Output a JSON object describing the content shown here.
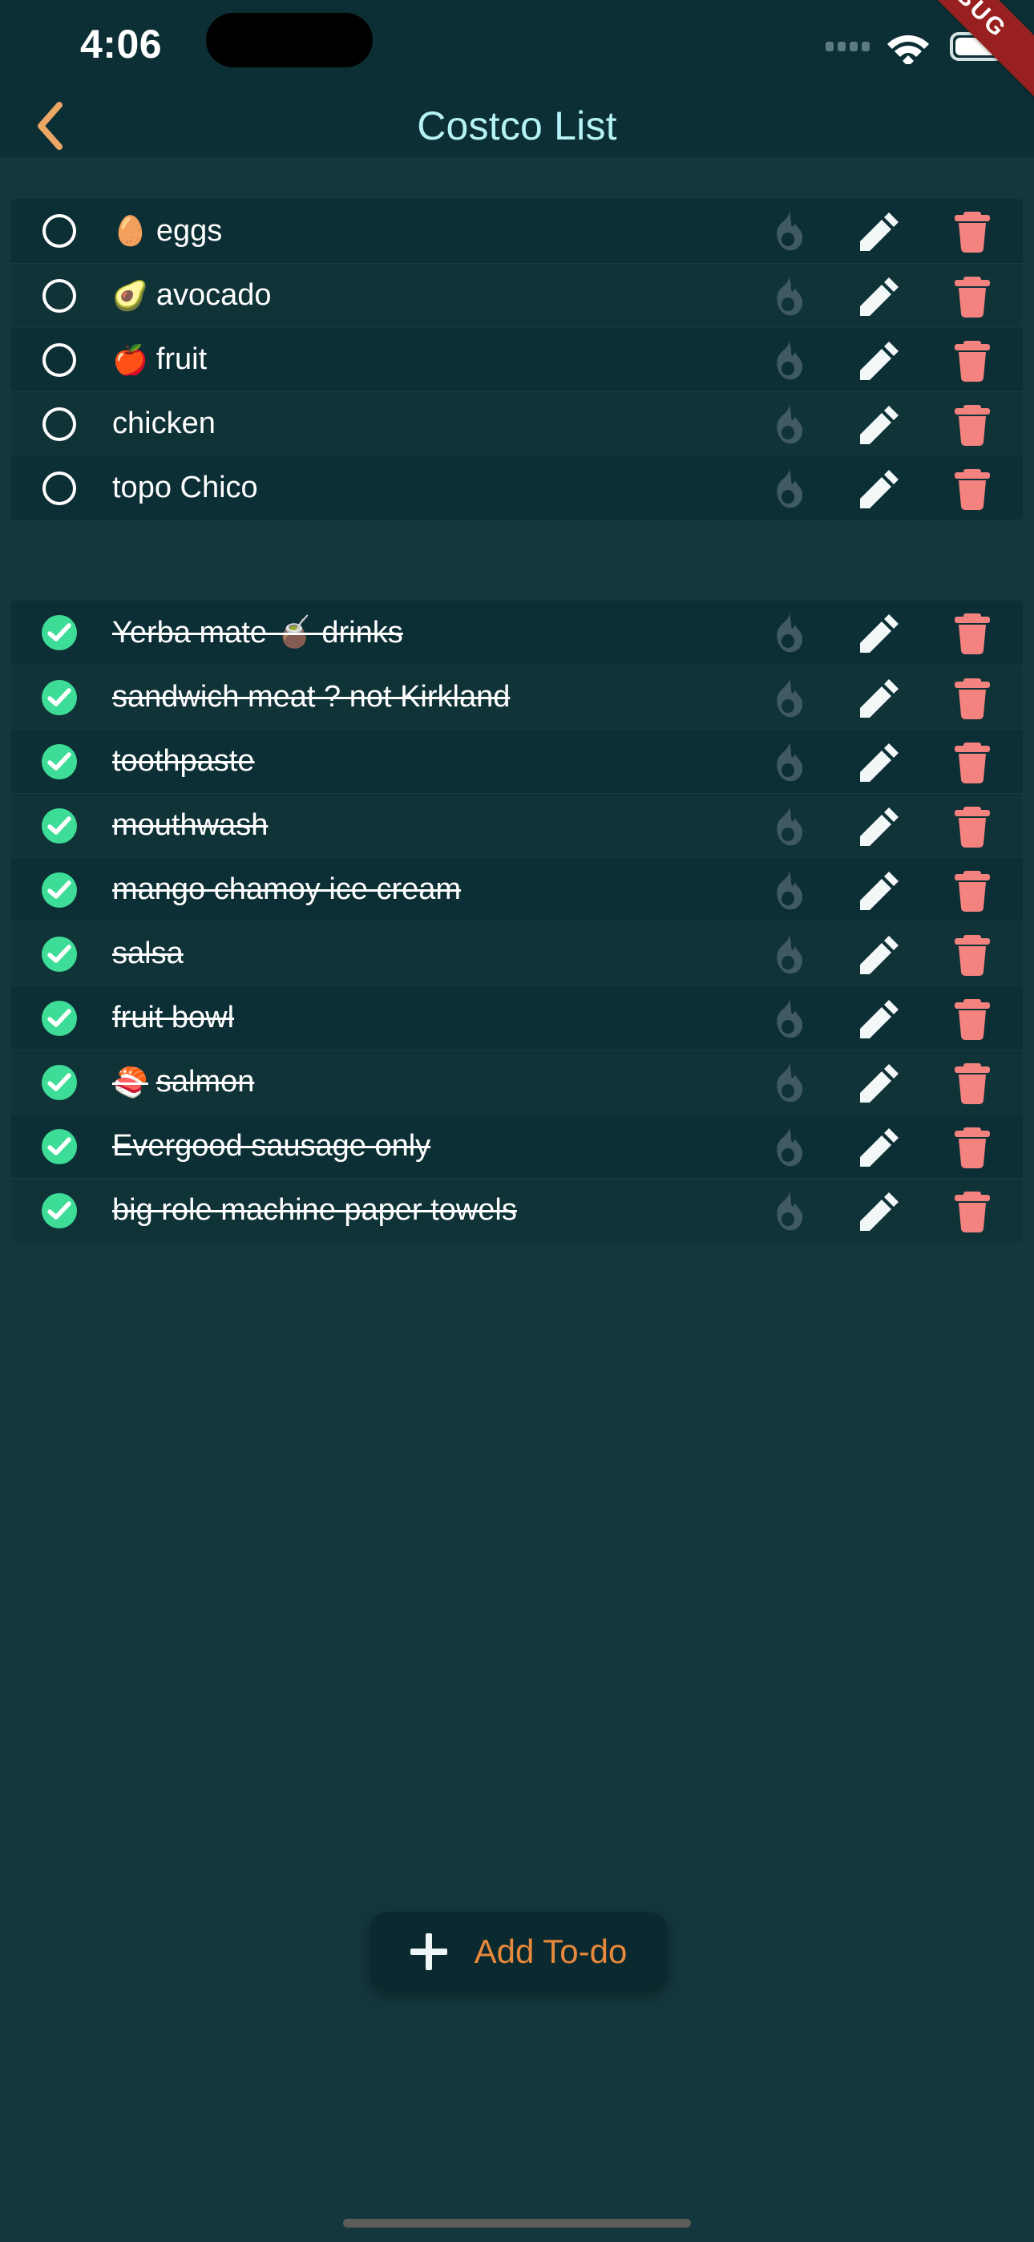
{
  "status_bar": {
    "time": "4:06",
    "cell_icon": "cellular-dots-icon",
    "wifi_icon": "wifi-icon",
    "battery_icon": "battery-icon"
  },
  "debug_ribbon": {
    "label": "DEBUG"
  },
  "nav": {
    "back_icon": "chevron-left-icon",
    "title": "Costco List"
  },
  "colors": {
    "page_bg": "#14373d",
    "card_bg": "#0c2f35",
    "header_bg": "#0c2f35",
    "title": "#b4f2f5",
    "accent_orange": "#e8883a",
    "check_green": "#3ddc97",
    "delete_red": "#f4827f",
    "flame_gray": "#3f5a60",
    "debug_red": "#98201e",
    "text": "#ffffff"
  },
  "row_actions": {
    "flame_icon": "flame-icon",
    "edit_icon": "pencil-icon",
    "delete_icon": "trash-icon"
  },
  "lists": [
    {
      "id": "active",
      "items": [
        {
          "emoji": "🥚",
          "text": "eggs",
          "done": false
        },
        {
          "emoji": "🥑",
          "text": "avocado",
          "done": false
        },
        {
          "emoji": "🍎",
          "text": "fruit",
          "done": false
        },
        {
          "emoji": "",
          "text": "chicken",
          "done": false
        },
        {
          "emoji": "",
          "text": "topo Chico",
          "done": false
        }
      ]
    },
    {
      "id": "completed",
      "items": [
        {
          "emoji": "",
          "text": "Yerba mate 🧉 drinks",
          "done": true
        },
        {
          "emoji": "",
          "text": "sandwich meat ? not Kirkland",
          "done": true
        },
        {
          "emoji": "",
          "text": "toothpaste",
          "done": true
        },
        {
          "emoji": "",
          "text": "mouthwash",
          "done": true
        },
        {
          "emoji": "",
          "text": "mango chamoy ice cream",
          "done": true
        },
        {
          "emoji": "",
          "text": "salsa",
          "done": true
        },
        {
          "emoji": "",
          "text": "fruit bowl",
          "done": true
        },
        {
          "emoji": "🍣",
          "text": "salmon",
          "done": true
        },
        {
          "emoji": "",
          "text": "Evergood sausage only",
          "done": true
        },
        {
          "emoji": "",
          "text": "big role machine paper towels",
          "done": true
        }
      ]
    }
  ],
  "fab": {
    "icon": "plus-icon",
    "label": "Add To-do"
  },
  "home_indicator": "home-indicator"
}
